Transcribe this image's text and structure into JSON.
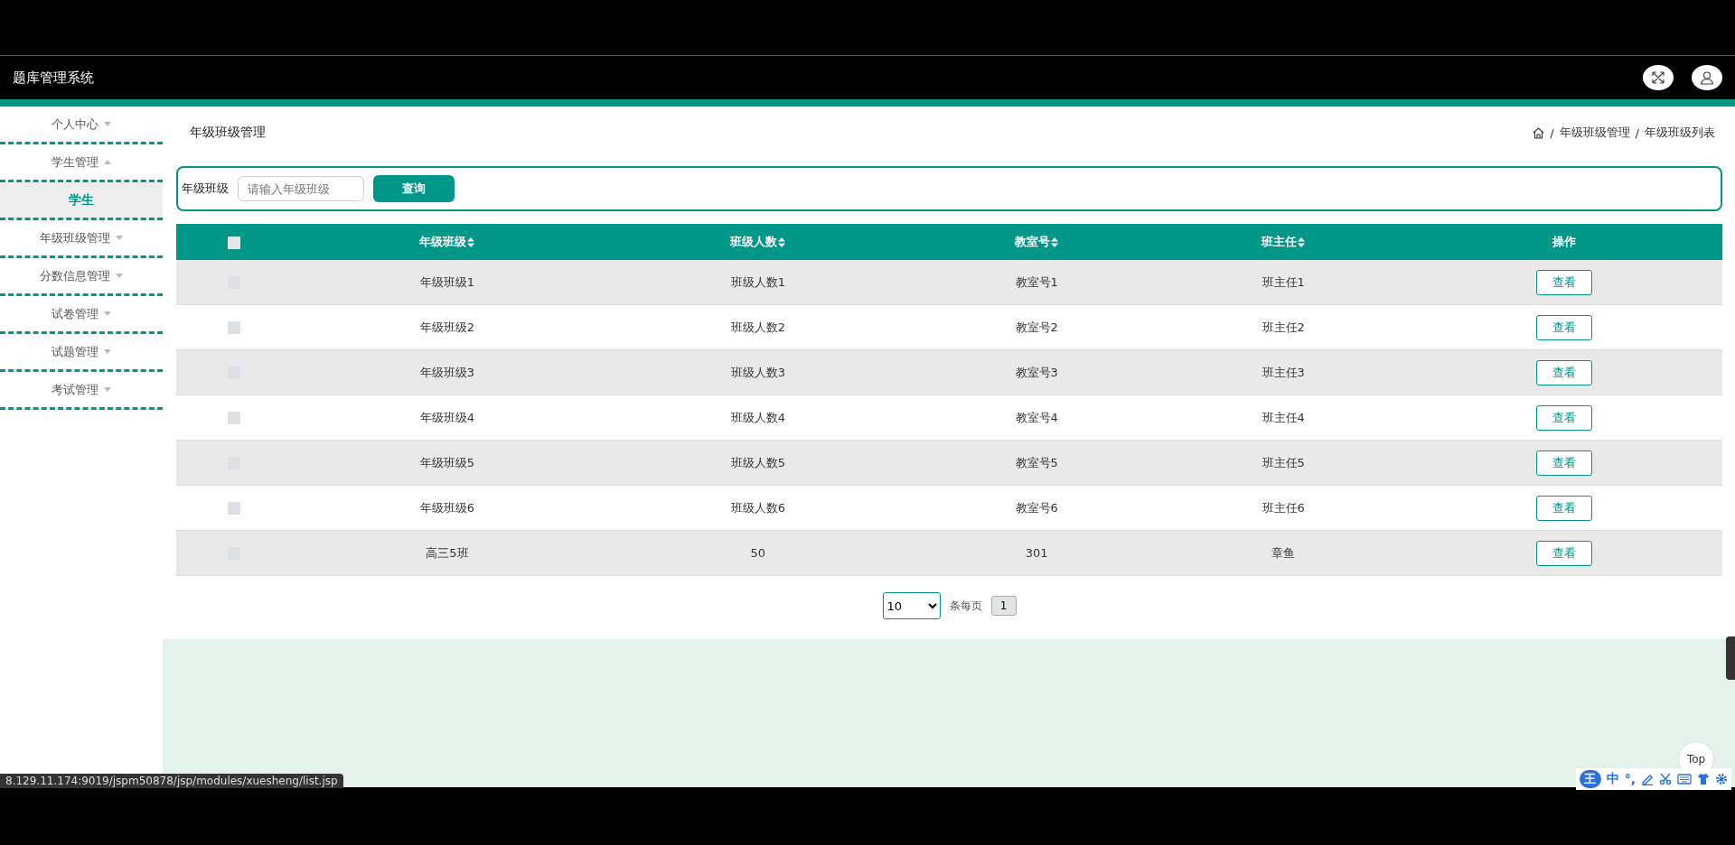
{
  "header": {
    "title": "题库管理系统"
  },
  "sidebar": {
    "items": [
      {
        "label": "个人中心",
        "expanded": false
      },
      {
        "label": "学生管理",
        "expanded": true,
        "children": [
          {
            "label": "学生",
            "selected": true
          }
        ]
      },
      {
        "label": "年级班级管理",
        "expanded": false
      },
      {
        "label": "分数信息管理",
        "expanded": false
      },
      {
        "label": "试卷管理",
        "expanded": false
      },
      {
        "label": "试题管理",
        "expanded": false
      },
      {
        "label": "考试管理",
        "expanded": false
      }
    ]
  },
  "page_title": "年级班级管理",
  "breadcrumb": {
    "separator": "/",
    "items": [
      "年级班级管理",
      "年级班级列表"
    ]
  },
  "search": {
    "label": "年级班级",
    "placeholder": "请输入年级班级",
    "button": "查询"
  },
  "table": {
    "columns": [
      "年级班级",
      "班级人数",
      "教室号",
      "班主任",
      "操作"
    ],
    "header_checked": false,
    "rows": [
      {
        "cells": [
          "年级班级1",
          "班级人数1",
          "教室号1",
          "班主任1"
        ],
        "action": "查看",
        "checked": false
      },
      {
        "cells": [
          "年级班级2",
          "班级人数2",
          "教室号2",
          "班主任2"
        ],
        "action": "查看",
        "checked": false
      },
      {
        "cells": [
          "年级班级3",
          "班级人数3",
          "教室号3",
          "班主任3"
        ],
        "action": "查看",
        "checked": false
      },
      {
        "cells": [
          "年级班级4",
          "班级人数4",
          "教室号4",
          "班主任4"
        ],
        "action": "查看",
        "checked": false
      },
      {
        "cells": [
          "年级班级5",
          "班级人数5",
          "教室号5",
          "班主任5"
        ],
        "action": "查看",
        "checked": false
      },
      {
        "cells": [
          "年级班级6",
          "班级人数6",
          "教室号6",
          "班主任6"
        ],
        "action": "查看",
        "checked": false
      },
      {
        "cells": [
          "高三5班",
          "50",
          "301",
          "章鱼"
        ],
        "action": "查看",
        "checked": false
      }
    ]
  },
  "pagination": {
    "page_size": "10",
    "per_page_label": "条每页",
    "pages": [
      {
        "label": "1",
        "selected": true
      }
    ]
  },
  "back_to_top": "Top",
  "status_url": "8.129.11.174:9019/jspm50878/jsp/modules/xuesheng/list.jsp",
  "ime_toolbar": {
    "logo": "王",
    "mode": "中",
    "punct": "°,"
  }
}
